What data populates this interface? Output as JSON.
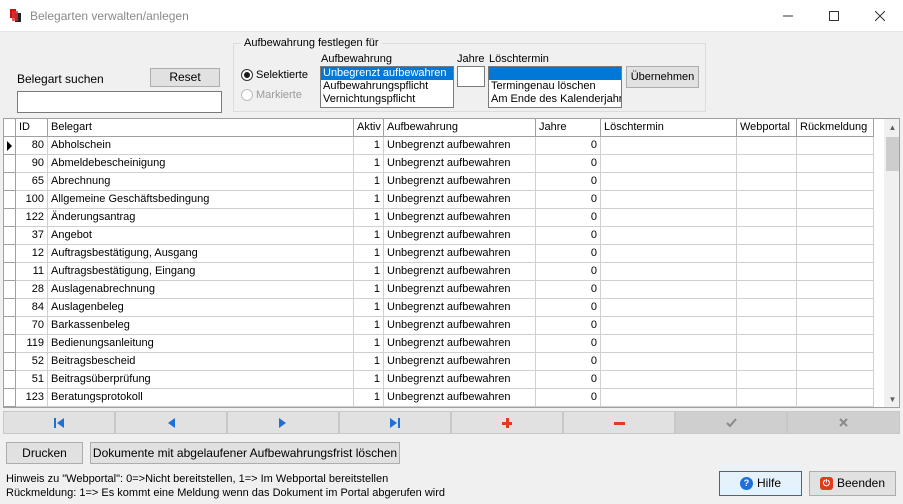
{
  "window": {
    "title": "Belegarten verwalten/anlegen"
  },
  "search": {
    "label": "Belegart suchen",
    "reset_label": "Reset",
    "value": ""
  },
  "group": {
    "title": "Aufbewahrung festlegen für",
    "radio_selektierte": "Selektierte",
    "radio_markierte": "Markierte",
    "aufbewahrung_label": "Aufbewahrung",
    "aufbewahrung_options": [
      "Unbegrenzt aufbewahren",
      "Aufbewahrungspflicht",
      "Vernichtungspflicht"
    ],
    "jahre_label": "Jahre",
    "jahre_value": "",
    "loeschtermin_label": "Löschtermin",
    "loeschtermin_options": [
      "",
      "Termingenau löschen",
      "Am Ende des Kalenderjahres"
    ],
    "uebernehmen_label": "Übernehmen"
  },
  "grid": {
    "columns": [
      "ID",
      "Belegart",
      "Aktiv",
      "Aufbewahrung",
      "Jahre",
      "Löschtermin",
      "Webportal",
      "Rückmeldung"
    ],
    "rows": [
      [
        "80",
        "Abholschein",
        "1",
        "Unbegrenzt aufbewahren",
        "0",
        "",
        "",
        ""
      ],
      [
        "90",
        "Abmeldebescheinigung",
        "1",
        "Unbegrenzt aufbewahren",
        "0",
        "",
        "",
        ""
      ],
      [
        "65",
        "Abrechnung",
        "1",
        "Unbegrenzt aufbewahren",
        "0",
        "",
        "",
        ""
      ],
      [
        "100",
        "Allgemeine Geschäftsbedingung",
        "1",
        "Unbegrenzt aufbewahren",
        "0",
        "",
        "",
        ""
      ],
      [
        "122",
        "Änderungsantrag",
        "1",
        "Unbegrenzt aufbewahren",
        "0",
        "",
        "",
        ""
      ],
      [
        "37",
        "Angebot",
        "1",
        "Unbegrenzt aufbewahren",
        "0",
        "",
        "",
        ""
      ],
      [
        "12",
        "Auftragsbestätigung, Ausgang",
        "1",
        "Unbegrenzt aufbewahren",
        "0",
        "",
        "",
        ""
      ],
      [
        "11",
        "Auftragsbestätigung, Eingang",
        "1",
        "Unbegrenzt aufbewahren",
        "0",
        "",
        "",
        ""
      ],
      [
        "28",
        "Auslagenabrechnung",
        "1",
        "Unbegrenzt aufbewahren",
        "0",
        "",
        "",
        ""
      ],
      [
        "84",
        "Auslagenbeleg",
        "1",
        "Unbegrenzt aufbewahren",
        "0",
        "",
        "",
        ""
      ],
      [
        "70",
        "Barkassenbeleg",
        "1",
        "Unbegrenzt aufbewahren",
        "0",
        "",
        "",
        ""
      ],
      [
        "119",
        "Bedienungsanleitung",
        "1",
        "Unbegrenzt aufbewahren",
        "0",
        "",
        "",
        ""
      ],
      [
        "52",
        "Beitragsbescheid",
        "1",
        "Unbegrenzt aufbewahren",
        "0",
        "",
        "",
        ""
      ],
      [
        "51",
        "Beitragsüberprüfung",
        "1",
        "Unbegrenzt aufbewahren",
        "0",
        "",
        "",
        ""
      ],
      [
        "123",
        "Beratungsprotokoll",
        "1",
        "Unbegrenzt aufbewahren",
        "0",
        "",
        "",
        ""
      ]
    ]
  },
  "bottom": {
    "drucken_label": "Drucken",
    "abgelaufen_label": "Dokumente mit abgelaufener Aufbewahrungsfrist löschen",
    "hint1": "Hinweis zu \"Webportal\": 0=>Nicht bereitstellen, 1=> Im Webportal bereitstellen",
    "hint2": "Rückmeldung: 1=> Es kommt eine Meldung wenn das Dokument im Portal abgerufen wird",
    "hilfe_label": "Hilfe",
    "beenden_label": "Beenden"
  },
  "colors": {
    "accent": "#0078d7",
    "nav_blue": "#1e6fd9",
    "nav_red": "#e03c1c"
  },
  "icons": {
    "app": "app-icon",
    "first": "first-record-icon",
    "prior": "prior-record-icon",
    "next": "next-record-icon",
    "last": "last-record-icon",
    "insert": "insert-icon",
    "delete": "delete-icon",
    "post": "check-icon",
    "cancel": "cancel-icon",
    "help": "help-icon",
    "exit": "power-icon"
  }
}
